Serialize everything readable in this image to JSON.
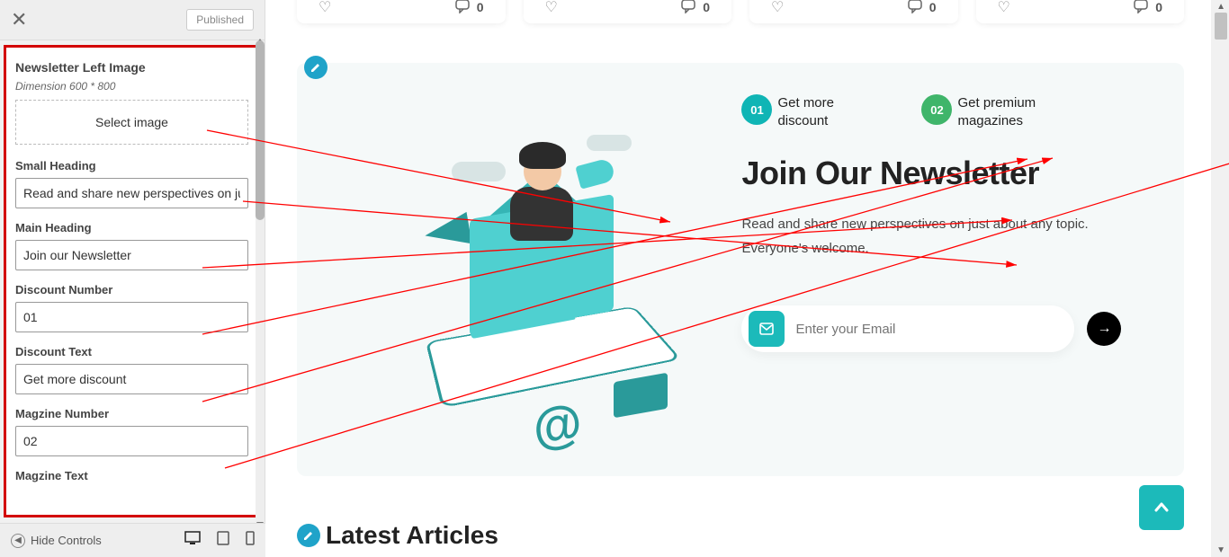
{
  "sidebar": {
    "top": {
      "published_label": "Published"
    },
    "section_title": "Newsletter Left Image",
    "dimension_note": "Dimension 600 * 800",
    "select_image_label": "Select image",
    "fields": {
      "small_heading": {
        "label": "Small Heading",
        "value": "Read and share new perspectives on just about any topic. Everyone's welcome."
      },
      "main_heading": {
        "label": "Main Heading",
        "value": "Join our Newsletter"
      },
      "discount_number": {
        "label": "Discount Number",
        "value": "01"
      },
      "discount_text": {
        "label": "Discount Text",
        "value": "Get more discount"
      },
      "magazine_number": {
        "label": "Magzine Number",
        "value": "02"
      },
      "magazine_text": {
        "label": "Magzine Text"
      }
    },
    "footer": {
      "hide_controls": "Hide Controls"
    }
  },
  "preview": {
    "cards": [
      {
        "comments": "0"
      },
      {
        "comments": "0"
      },
      {
        "comments": "0"
      },
      {
        "comments": "0"
      }
    ],
    "newsletter": {
      "badges": {
        "discount": {
          "num": "01",
          "text": "Get more discount"
        },
        "magazine": {
          "num": "02",
          "text": "Get premium magazines"
        }
      },
      "heading": "Join Our Newsletter",
      "subheading": "Read and share new perspectives on just about any topic. Everyone's welcome.",
      "email_placeholder": "Enter your Email",
      "send_arrow": "→"
    },
    "latest_articles_title": "Latest Articles"
  }
}
